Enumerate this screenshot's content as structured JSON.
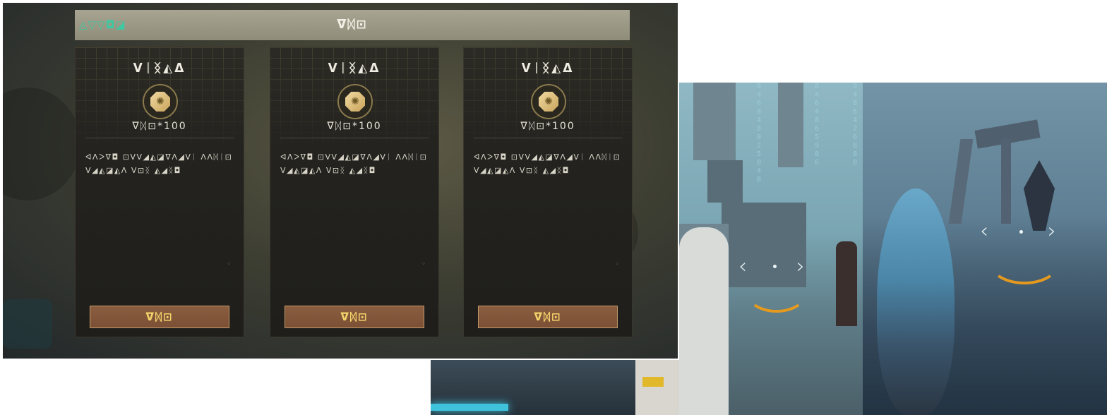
{
  "shop": {
    "header_left": "◬▽▽◘◪",
    "header_title": "ᐁᛞ⊡",
    "cards": [
      {
        "title": "ᐯᛁᛝ◭ᐃ",
        "price": "ᐁᛞ⊡*100",
        "description": "ᐊᐱᐳᐁ◘ ⊡ᐯᐯ◢◭◪ᐁᐱ◢ᐯᛁ ᐱᐱᛞᛁ⊡ᐯ◢◭◪◭ᐱ ᐯ⊡ᛝ ◭◢ᛝ◘",
        "button": "ᐁᛞ⊡"
      },
      {
        "title": "ᐯᛁᛝ◭ᐃ",
        "price": "ᐁᛞ⊡*100",
        "description": "ᐊᐱᐳᐁ◘ ⊡ᐯᐯ◢◭◪ᐁᐱ◢ᐯᛁ ᐱᐱᛞᛁ⊡ᐯ◢◭◪◭ᐱ ᐯ⊡ᛝ ◭◢ᛝ◘",
        "button": "ᐁᛞ⊡"
      },
      {
        "title": "ᐯᛁᛝ◭ᐃ",
        "price": "ᐁᛞ⊡*100",
        "description": "ᐊᐱᐳᐁ◘ ⊡ᐯᐯ◢◭◪ᐁᐱ◢ᐯᛁ ᐱᐱᛞᛁ⊡ᐯ◢◭◪◭ᐱ ᐯ⊡ᛝ ◭◢ᛝ◘",
        "button": "ᐁᛞ⊡"
      }
    ]
  },
  "city_scene": {
    "digit_columns": [
      "046848025048",
      "8464865986",
      "0486426880"
    ],
    "arrow_left": "‹",
    "arrow_right": "›"
  },
  "sea_scene": {
    "arrow_left": "‹",
    "arrow_right": "›"
  },
  "colors": {
    "accent_green": "#3dc9a2",
    "button_gold": "#f4d36a",
    "button_bg": "#8a5d3f",
    "target_arc": "#e59a1e"
  }
}
